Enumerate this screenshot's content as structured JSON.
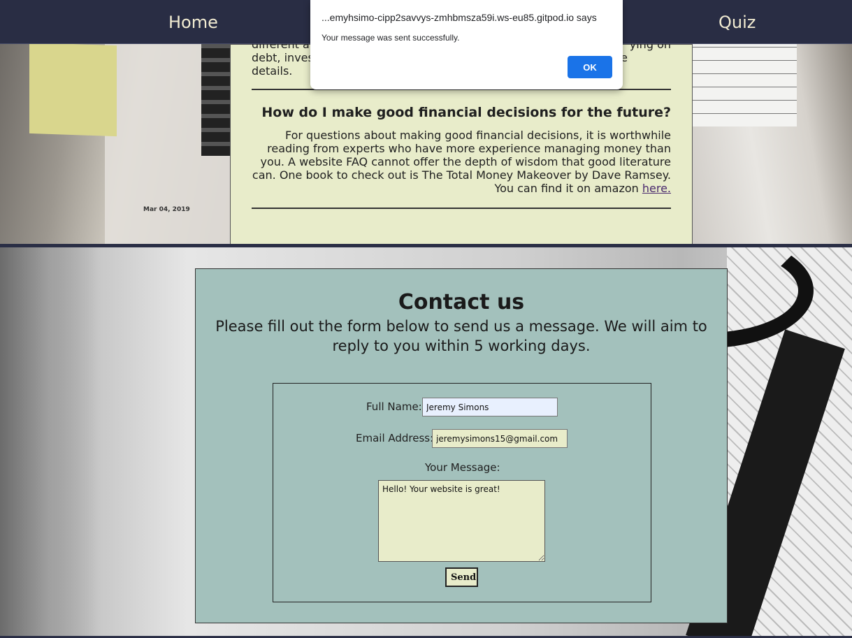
{
  "nav": {
    "home_label": "Home",
    "quiz_label": "Quiz"
  },
  "alert": {
    "origin": "...emyhsimo-cipp2savvys-zmhbmsza59i.ws-eu85.gitpod.io says",
    "message": "Your message was sent successfully.",
    "ok_label": "OK"
  },
  "faq": {
    "partial_line_1": "different a",
    "partial_line_1_right": "ying on",
    "partial_line_2": "debt, inves",
    "partial_line_2_right": "e",
    "partial_line_3": "details.",
    "question": "How do I make good financial decisions for the future?",
    "answer_lines": [
      "For questions about making good financial decisions, it is worthwhile",
      "reading from experts who have more experience managing money than",
      "you. A website FAQ cannot offer the depth of wisdom that good literature",
      "can. One book to check out is The Total Money Makeover by Dave Ramsey."
    ],
    "answer_last_prefix": "You can find it on amazon ",
    "answer_link": "here."
  },
  "background": {
    "date_text": "Mar 04, 2019"
  },
  "contact": {
    "title": "Contact us",
    "intro": "Please fill out the form below to send us a message. We will aim to reply to you within 5 working days.",
    "full_name_label": "Full Name:",
    "full_name_value": "Jeremy Simons",
    "email_label": "Email Address:",
    "email_value": "jeremysimons15@gmail.com",
    "message_label": "Your Message:",
    "message_value": "Hello! Your website is great!",
    "send_label": "Send"
  },
  "colors": {
    "nav_bg": "#292d44",
    "faq_panel_bg": "#e8ecca",
    "contact_panel_bg": "#a3c1bc",
    "alert_button": "#1a73e8"
  }
}
